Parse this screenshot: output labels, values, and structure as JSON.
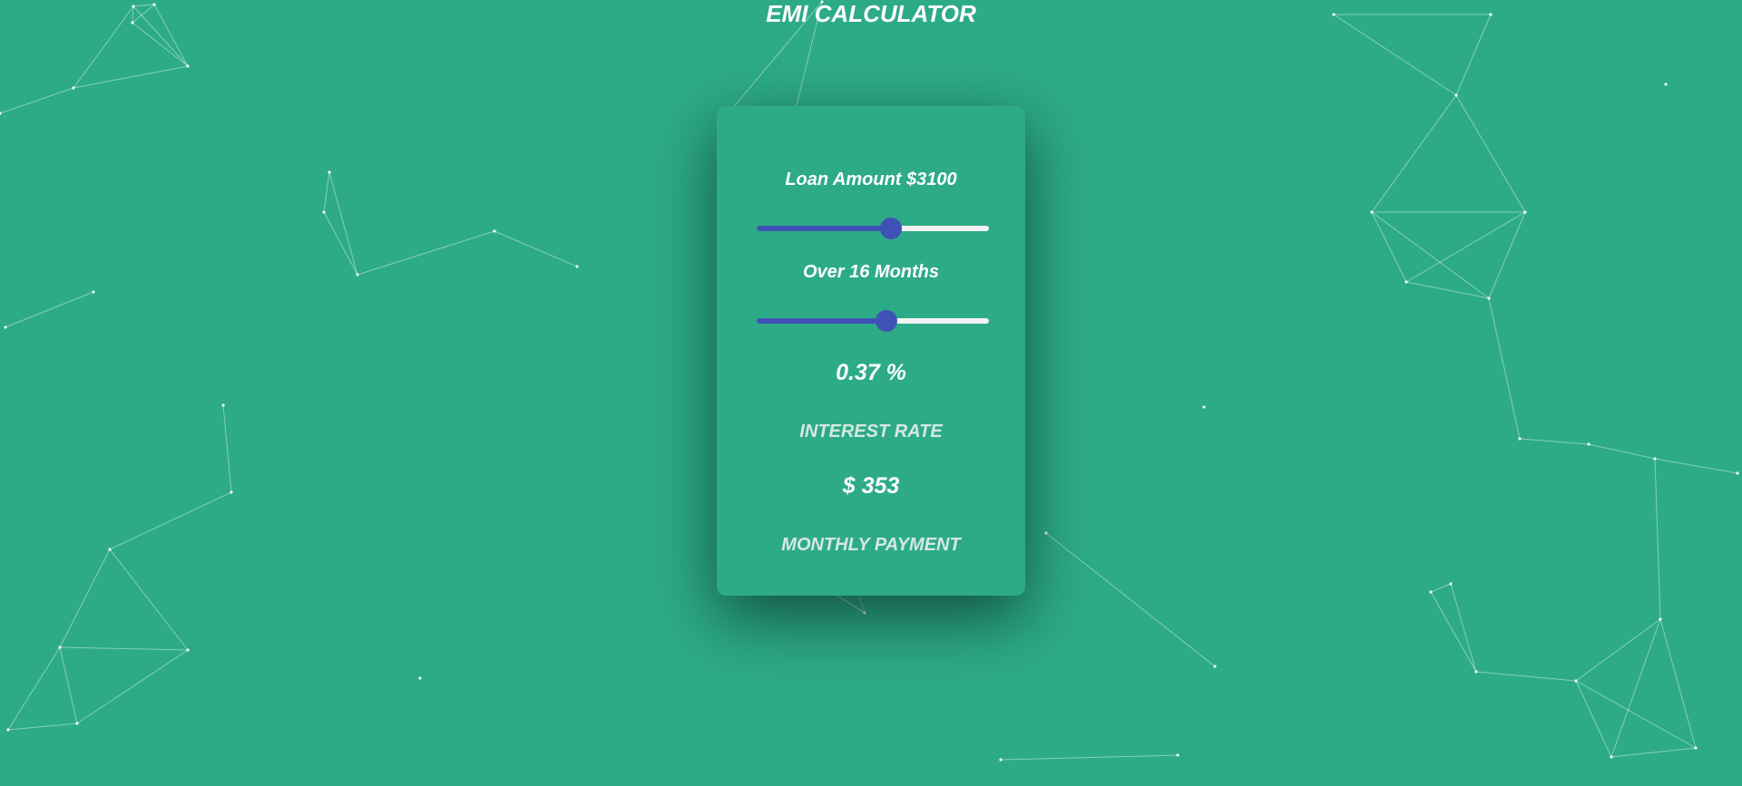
{
  "app": {
    "title": "EMI CALCULATOR"
  },
  "loan": {
    "label": "Loan Amount $3100",
    "slider_fraction": 0.58
  },
  "months": {
    "label": "Over 16 Months",
    "slider_fraction": 0.56
  },
  "interest": {
    "value": "0.37 %",
    "caption": "INTEREST RATE"
  },
  "payment": {
    "value": "$ 353",
    "caption": "MONTHLY PAYMENT"
  },
  "colors": {
    "background": "#2dab87",
    "accent": "#3f51b5",
    "track": "#f2f2f2",
    "text": "#ffffff",
    "caption": "#d6e8e1"
  }
}
